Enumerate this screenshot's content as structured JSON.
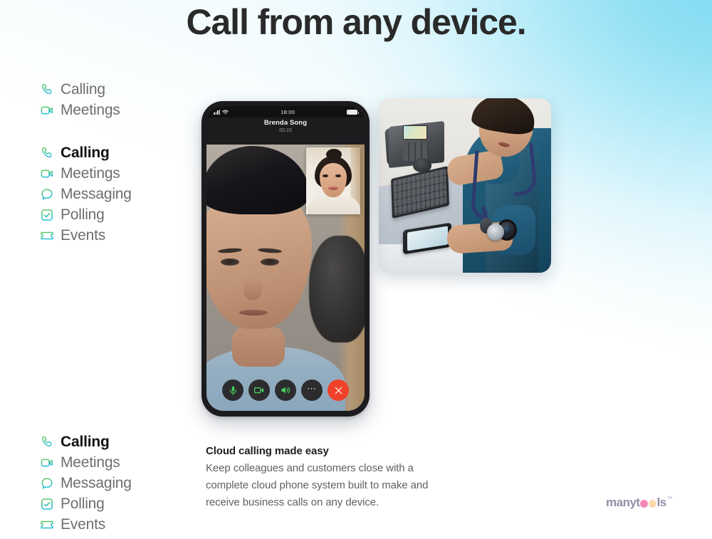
{
  "page": {
    "title": "Call from any device.",
    "background_accent": "#7ad8f0",
    "background_base": "#ffffff"
  },
  "feature_groups": [
    {
      "group_name": "compact-list",
      "items": [
        {
          "label": "Calling",
          "icon": "phone-icon",
          "active": false
        },
        {
          "label": "Meetings",
          "icon": "video-camera-icon",
          "active": false
        }
      ]
    },
    {
      "group_name": "primary-list",
      "items": [
        {
          "label": "Calling",
          "icon": "phone-icon",
          "active": true
        },
        {
          "label": "Meetings",
          "icon": "video-camera-icon",
          "active": false
        },
        {
          "label": "Messaging",
          "icon": "chat-bubble-icon",
          "active": false
        },
        {
          "label": "Polling",
          "icon": "checkbox-icon",
          "active": false
        },
        {
          "label": "Events",
          "icon": "ticket-icon",
          "active": false
        }
      ]
    },
    {
      "group_name": "secondary-list",
      "items": [
        {
          "label": "Calling",
          "icon": "phone-icon",
          "active": true
        },
        {
          "label": "Meetings",
          "icon": "video-camera-icon",
          "active": false
        },
        {
          "label": "Messaging",
          "icon": "chat-bubble-icon",
          "active": false
        },
        {
          "label": "Polling",
          "icon": "checkbox-icon",
          "active": false
        },
        {
          "label": "Events",
          "icon": "ticket-icon",
          "active": false
        }
      ]
    }
  ],
  "icon_colors": {
    "gradient_start": "#5ec95a",
    "gradient_end": "#29bfd6",
    "label_default": "#6e6e6e",
    "label_active": "#121212"
  },
  "phone_mockup": {
    "status_bar": {
      "clock": "18:00",
      "signal_icon": "signal-bars-icon",
      "wifi_icon": "wifi-icon",
      "battery_icon": "battery-icon"
    },
    "call": {
      "callee_name": "Brenda Song",
      "duration": "00:23",
      "main_video_label": "remote-participant-video",
      "pip_video_label": "self-view-video"
    },
    "controls": [
      {
        "name": "mute-button",
        "icon": "microphone-icon",
        "style": "dark",
        "accent": "#4ad45f"
      },
      {
        "name": "video-button",
        "icon": "video-camera-icon",
        "style": "dark",
        "accent": "#4ad45f"
      },
      {
        "name": "speaker-button",
        "icon": "speaker-icon",
        "style": "dark",
        "accent": "#4ad45f"
      },
      {
        "name": "more-button",
        "icon": "ellipsis-icon",
        "style": "dark",
        "accent": "#e6e6e6"
      },
      {
        "name": "end-call-button",
        "icon": "close-x-icon",
        "style": "red",
        "accent": "#ffffff"
      }
    ],
    "end_call_color": "#f0422a"
  },
  "photo_card": {
    "alt": "healthcare-worker-using-desk-phone-keyboard-and-smartphone",
    "scrubs_color": "#1f5b79"
  },
  "caption": {
    "title": "Cloud calling made easy",
    "body": "Keep colleagues and customers close with a complete cloud phone system built to make and receive business calls on any device."
  },
  "logo": {
    "part1": "manyt",
    "part2": "ls",
    "trademark": "™",
    "dot1_color": "#f587b8",
    "dot2_color": "#fbd9b0",
    "text_color": "#8f8fa8"
  }
}
